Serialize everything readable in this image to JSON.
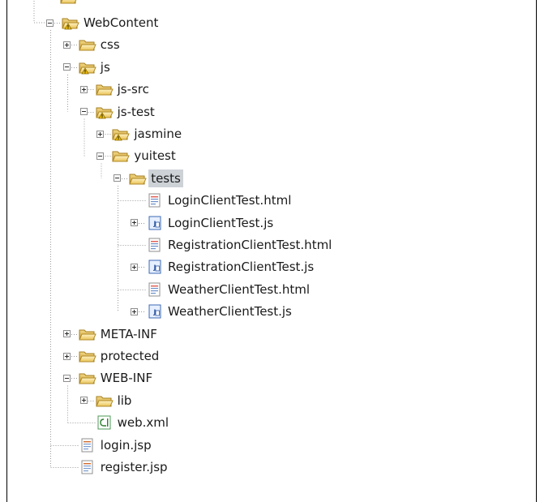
{
  "tree": [
    {
      "label": "WebContent",
      "icon": "folder-warning-icon",
      "depth": 0,
      "expanded": true,
      "selected": false
    },
    {
      "label": "css",
      "icon": "folder-icon",
      "depth": 1,
      "expanded": false,
      "selected": false
    },
    {
      "label": "js",
      "icon": "folder-warning-icon",
      "depth": 1,
      "expanded": true,
      "selected": false
    },
    {
      "label": "js-src",
      "icon": "folder-icon",
      "depth": 2,
      "expanded": false,
      "selected": false
    },
    {
      "label": "js-test",
      "icon": "folder-warning-icon",
      "depth": 2,
      "expanded": true,
      "selected": false
    },
    {
      "label": "jasmine",
      "icon": "folder-warning-icon",
      "depth": 3,
      "expanded": false,
      "selected": false
    },
    {
      "label": "yuitest",
      "icon": "folder-icon",
      "depth": 3,
      "expanded": true,
      "selected": false
    },
    {
      "label": "tests",
      "icon": "folder-icon",
      "depth": 4,
      "expanded": true,
      "selected": true
    },
    {
      "label": "LoginClientTest.html",
      "icon": "html-file-icon",
      "depth": 5,
      "expanded": null,
      "selected": false
    },
    {
      "label": "LoginClientTest.js",
      "icon": "js-file-icon",
      "depth": 5,
      "expanded": false,
      "selected": false
    },
    {
      "label": "RegistrationClientTest.html",
      "icon": "html-file-icon",
      "depth": 5,
      "expanded": null,
      "selected": false
    },
    {
      "label": "RegistrationClientTest.js",
      "icon": "js-file-icon",
      "depth": 5,
      "expanded": false,
      "selected": false
    },
    {
      "label": "WeatherClientTest.html",
      "icon": "html-file-icon",
      "depth": 5,
      "expanded": null,
      "selected": false
    },
    {
      "label": "WeatherClientTest.js",
      "icon": "js-file-icon",
      "depth": 5,
      "expanded": false,
      "selected": false
    },
    {
      "label": "META-INF",
      "icon": "folder-icon",
      "depth": 1,
      "expanded": false,
      "selected": false
    },
    {
      "label": "protected",
      "icon": "folder-icon",
      "depth": 1,
      "expanded": false,
      "selected": false
    },
    {
      "label": "WEB-INF",
      "icon": "folder-icon",
      "depth": 1,
      "expanded": true,
      "selected": false
    },
    {
      "label": "lib",
      "icon": "folder-icon",
      "depth": 2,
      "expanded": false,
      "selected": false
    },
    {
      "label": "web.xml",
      "icon": "xml-file-icon",
      "depth": 2,
      "expanded": null,
      "selected": false
    },
    {
      "label": "login.jsp",
      "icon": "jsp-file-icon",
      "depth": 1,
      "expanded": null,
      "selected": false
    },
    {
      "label": "register.jsp",
      "icon": "jsp-file-icon",
      "depth": 1,
      "expanded": null,
      "selected": false
    }
  ]
}
